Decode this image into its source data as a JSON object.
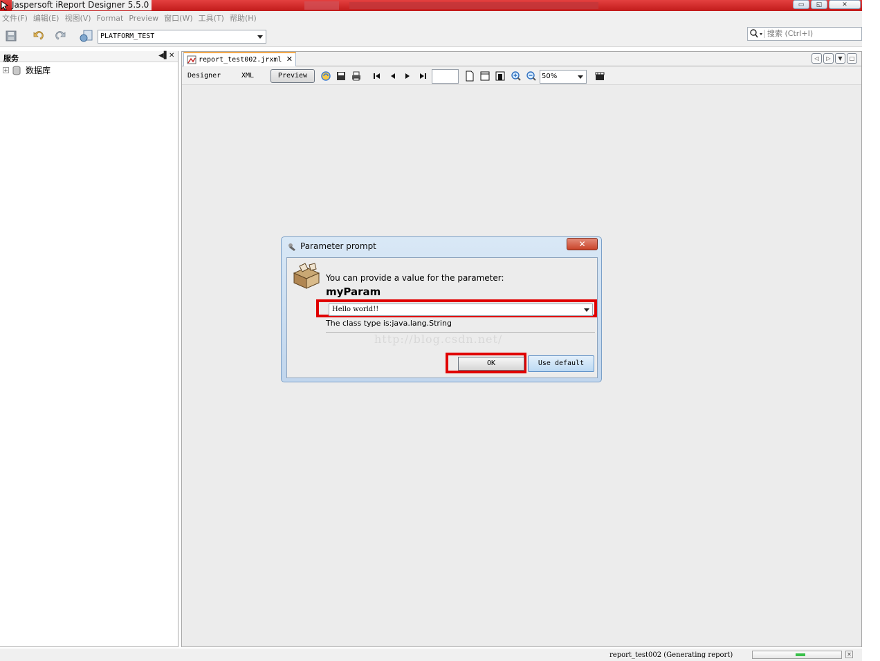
{
  "window": {
    "title": "Jaspersoft iReport Designer 5.5.0"
  },
  "menu": [
    "文件(F)",
    "编辑(E)",
    "视图(V)",
    "Format",
    "Preview",
    "窗口(W)",
    "工具(T)",
    "帮助(H)"
  ],
  "toolbar": {
    "connection_value": "PLATFORM_TEST",
    "search_placeholder": "搜索 (Ctrl+I)"
  },
  "left_panel": {
    "title": "服务",
    "tree_item": "数据库"
  },
  "editor": {
    "tab_label": "report_test002.jrxml",
    "views": [
      "Designer",
      "XML",
      "Preview"
    ],
    "active_view": "Preview",
    "page_number": "",
    "zoom": "50%"
  },
  "dialog": {
    "title": "Parameter prompt",
    "prompt": "You can provide a value for the parameter:",
    "param_name": "myParam",
    "value": "Hello world!!",
    "class_type": "The class type is:java.lang.String",
    "watermark": "http://blog.csdn.net/",
    "ok_label": "OK",
    "use_default_label": "Use default"
  },
  "status": {
    "text": "report_test002 (Generating report)",
    "progress": 0.5
  },
  "colors": {
    "highlight": "#e00000",
    "title_bar": "#c21b1b",
    "dialog_frame": "#c1d6ed"
  }
}
